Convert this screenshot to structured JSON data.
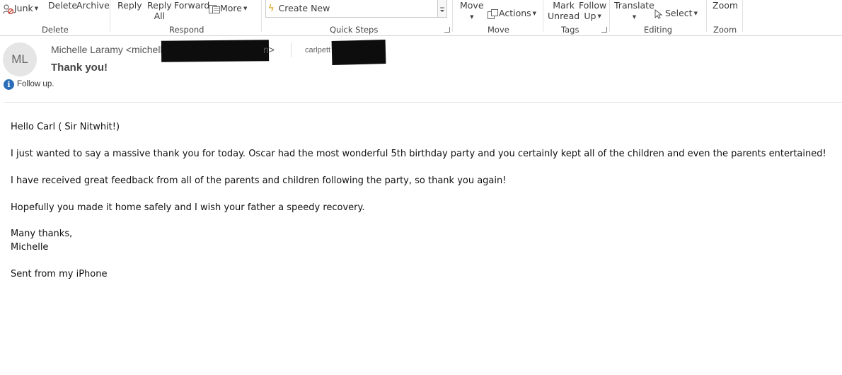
{
  "ribbon": {
    "delete_group": {
      "junk_label": "Junk",
      "delete_label": "Delete",
      "archive_label": "Archive",
      "group_label": "Delete"
    },
    "respond_group": {
      "reply_label": "Reply",
      "reply_all_line1": "Reply",
      "reply_all_line2": "All",
      "forward_label": "Forward",
      "more_label": "More",
      "group_label": "Respond"
    },
    "quick_steps_group": {
      "create_new_label": "Create New",
      "group_label": "Quick Steps"
    },
    "move_group": {
      "move_label": "Move",
      "actions_label": "Actions",
      "group_label": "Move"
    },
    "tags_group": {
      "mark_unread_line1": "Mark",
      "mark_unread_line2": "Unread",
      "follow_up_line1": "Follow",
      "follow_up_line2": "Up",
      "group_label": "Tags"
    },
    "editing_group": {
      "translate_label": "Translate",
      "select_label": "Select",
      "group_label": "Editing"
    },
    "zoom_group": {
      "zoom_label": "Zoom",
      "group_label": "Zoom"
    }
  },
  "message": {
    "avatar_initials": "ML",
    "from_text": "Michelle Laramy <michellelara",
    "from_suffix": "n>",
    "to_text": "carlpett",
    "subject": "Thank you!",
    "infobar_text": "Follow up.",
    "body_lines": [
      "Hello Carl ( Sir Nitwhit!)",
      "I just wanted to say a massive thank you for today.  Oscar had the most wonderful 5th birthday party and you certainly kept all of the children and even the parents entertained!",
      "I have received great feedback from all of the parents and children following the party, so thank you again!",
      "Hopefully you made it home safely and I wish your father a speedy recovery.",
      "Many thanks,",
      "Michelle",
      "Sent from my iPhone"
    ]
  },
  "colors": {
    "info_icon": "#2b6cb8",
    "redaction": "#0d0d0d",
    "avatar_bg": "#e5e5e5"
  }
}
